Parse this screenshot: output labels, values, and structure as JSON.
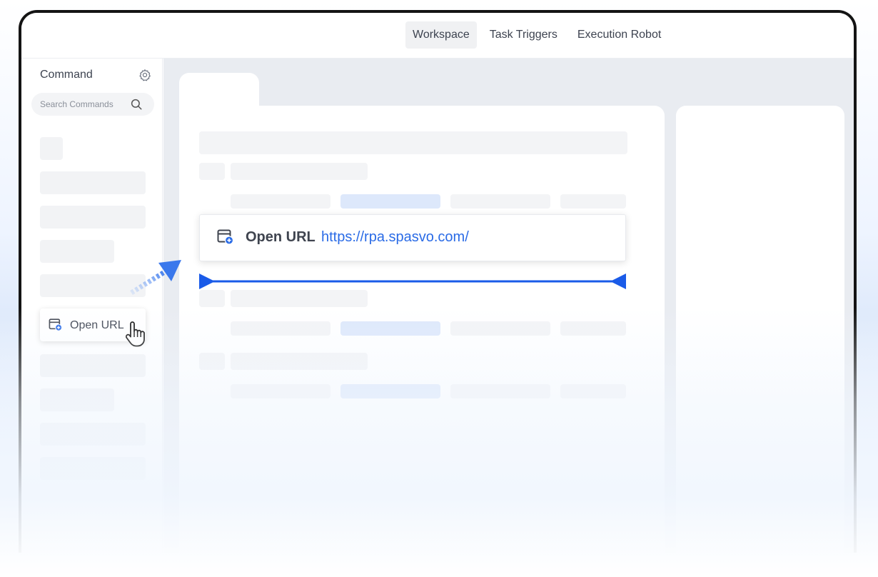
{
  "nav": {
    "items": [
      {
        "label": "Workspace",
        "active": true
      },
      {
        "label": "Task Triggers",
        "active": false
      },
      {
        "label": "Execution Robot",
        "active": false
      }
    ]
  },
  "sidebar": {
    "title": "Command",
    "search_placeholder": "Search Commands",
    "dragged_item": {
      "label": "Open URL",
      "icon": "browser-plus-icon"
    }
  },
  "command_card": {
    "label": "Open URL",
    "url": "https://rpa.spasvo.com/",
    "icon": "browser-plus-icon"
  },
  "colors": {
    "accent": "#2a6be6",
    "skeleton": "#f3f4f6",
    "skeleton_blue": "#dde8fb",
    "frame_border": "#141414",
    "canvas_bg": "#e9ecf1"
  }
}
